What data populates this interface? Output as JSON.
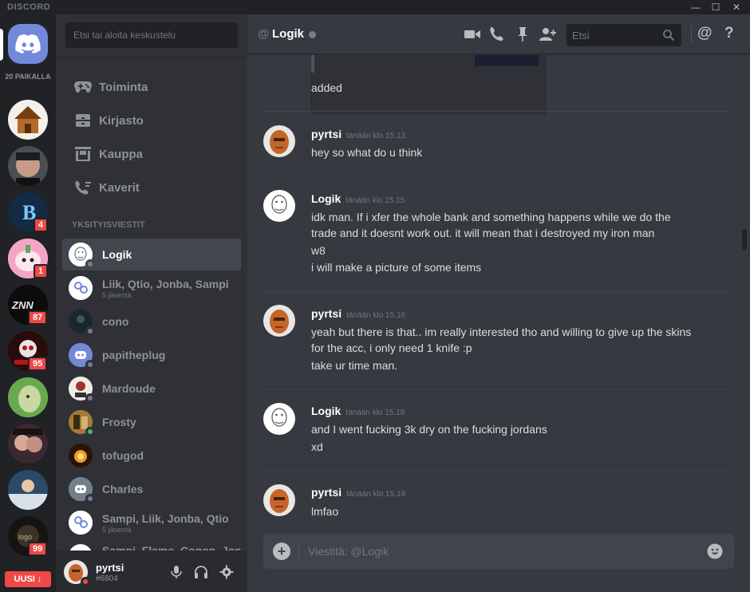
{
  "app": {
    "brand": "DISCORD"
  },
  "window": {
    "minimize": "—",
    "maximize": "☐",
    "close": "✕"
  },
  "guilds": {
    "online_count": "20 PAIKALLA",
    "items": [
      {
        "badge": ""
      },
      {
        "badge": ""
      },
      {
        "badge": "4"
      },
      {
        "badge": "1"
      },
      {
        "badge": "87"
      },
      {
        "badge": "95"
      },
      {
        "badge": ""
      },
      {
        "badge": ""
      },
      {
        "badge": ""
      },
      {
        "badge": "99"
      }
    ],
    "new_button": "UUSI ↓"
  },
  "sidebar": {
    "search_placeholder": "Etsi tai aloita keskustelu",
    "nav": [
      {
        "label": "Toiminta",
        "icon": "gamepad-icon"
      },
      {
        "label": "Kirjasto",
        "icon": "library-icon"
      },
      {
        "label": "Kauppa",
        "icon": "store-icon"
      },
      {
        "label": "Kaverit",
        "icon": "friends-icon"
      }
    ],
    "section_title": "YKSITYISVIESTIT",
    "dms": [
      {
        "name": "Logik",
        "sub": ""
      },
      {
        "name": "Liik, Qtio, Jonba, Sampi",
        "sub": "5 jäsentä"
      },
      {
        "name": "cono",
        "sub": ""
      },
      {
        "name": "papitheplug",
        "sub": ""
      },
      {
        "name": "Mardoude",
        "sub": ""
      },
      {
        "name": "Frosty",
        "sub": ""
      },
      {
        "name": "tofugod",
        "sub": ""
      },
      {
        "name": "Charles",
        "sub": ""
      },
      {
        "name": "Sampi, Liik, Jonba, Qtio",
        "sub": "5 jäsentä"
      },
      {
        "name": "Sampi, Flame, Conon, Jonba",
        "sub": ""
      }
    ],
    "user": {
      "name": "pyrtsi",
      "tag": "#6804"
    }
  },
  "chat": {
    "at_symbol": "@",
    "channel_name": "Logik",
    "search_placeholder": "Etsi",
    "mention_icon": "@",
    "help_icon": "?",
    "messages": [
      {
        "author": "",
        "time": "",
        "lines": [
          "added"
        ]
      },
      {
        "author": "pyrtsi",
        "time": "tänään klo 15.13",
        "lines": [
          "hey so what do u think"
        ]
      },
      {
        "author": "Logik",
        "time": "tänään klo 15.15",
        "lines": [
          "idk man. If i xfer the whole bank and something happens while we do the",
          "trade and it doesnt work out. it will mean that i destroyed my iron man",
          "w8",
          "i will make a picture of some items"
        ]
      },
      {
        "author": "pyrtsi",
        "time": "tänään klo 15.16",
        "lines": [
          "yeah but there is that.. im really interested tho and willing to give up the skins",
          "for the acc, i only need 1 knife :p",
          "take ur time man."
        ]
      },
      {
        "author": "Logik",
        "time": "tänään klo 15.18",
        "lines": [
          "and I went fucking 3k dry on the fucking jordans",
          "xd"
        ]
      },
      {
        "author": "pyrtsi",
        "time": "tänään klo 15.19",
        "lines": [
          "lmfao"
        ]
      }
    ],
    "composer_placeholder": "Viestitä: @Logik"
  },
  "colors": {
    "blurple": "#7289da",
    "background_tertiary": "#202225",
    "background_secondary": "#2f3136",
    "background_primary": "#36393f",
    "danger": "#f04747",
    "online": "#43b581",
    "offline": "#747f8d"
  }
}
